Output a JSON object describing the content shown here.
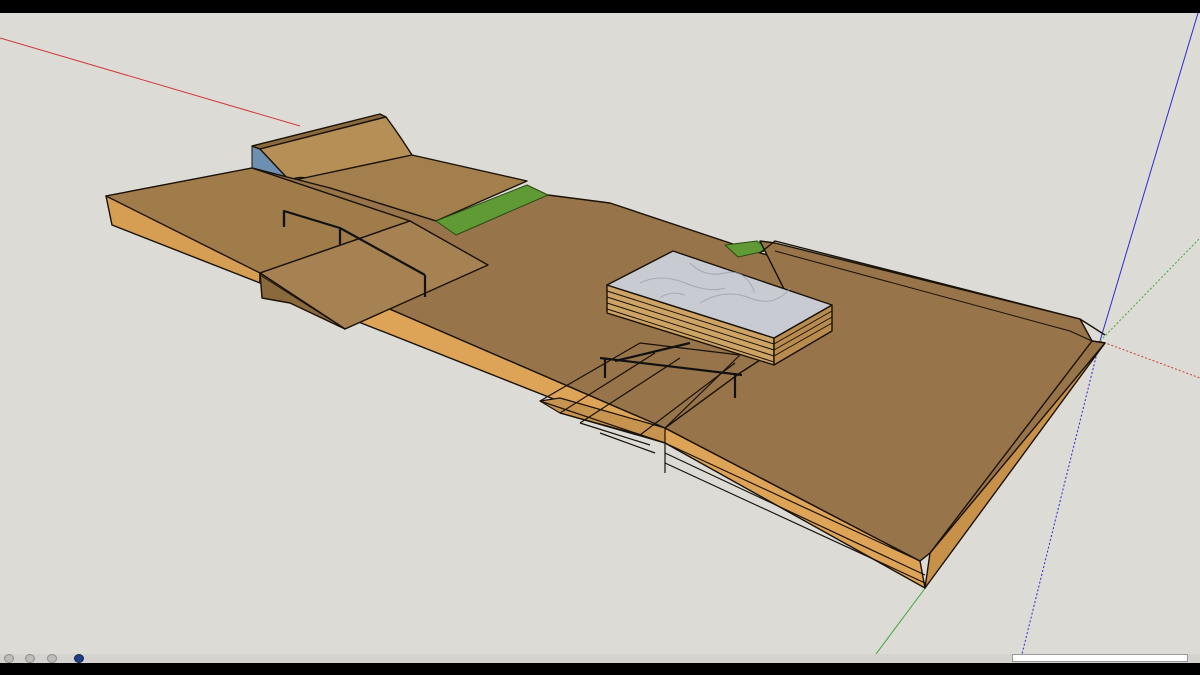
{
  "window": {
    "app": "SketchUp"
  },
  "viewport": {
    "background_color": "#dcdbd6",
    "axes": {
      "red_axis_color": "#d23a3a",
      "blue_axis_color": "#2b2bd6",
      "green_axis_color": "#3aa83a"
    },
    "model": {
      "wood_top_color": "#987a4d",
      "wood_side_color": "#d9a155",
      "grass_color": "#5f9a35",
      "marble_color": "#c8ccd2",
      "rail_color": "#111111"
    }
  },
  "statusbar": {
    "hint_text": "",
    "measurements_label": "",
    "measurements_value": "",
    "icons": [
      "geo-location-icon",
      "credits-icon",
      "help-icon",
      "instructor-icon"
    ]
  }
}
